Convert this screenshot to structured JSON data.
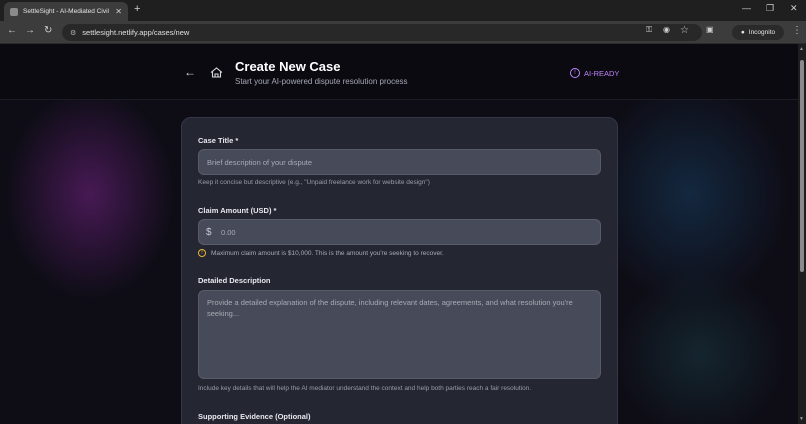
{
  "browser": {
    "tab_title": "SettleSight - AI-Mediated Civil Dispute",
    "tab_close": "✕",
    "new_tab": "+",
    "url": "settlesight.netlify.app/cases/new",
    "incognito_label": "Incognito",
    "window_controls": [
      "—",
      "❐",
      "✕"
    ]
  },
  "header": {
    "title": "Create New Case",
    "subtitle": "Start your AI-powered dispute resolution process",
    "badge": "AI-READY",
    "badge_color": "#c084fc"
  },
  "form": {
    "case_title": {
      "label": "Case Title *",
      "placeholder": "Brief description of your dispute",
      "help": "Keep it concise but descriptive (e.g., \"Unpaid freelance work for website design\")"
    },
    "claim_amount": {
      "label": "Claim Amount (USD) *",
      "currency_symbol": "$",
      "placeholder": "0.00",
      "warning": "Maximum claim amount is $10,000. This is the amount you're seeking to recover.",
      "warning_color": "#e4b33c"
    },
    "description": {
      "label": "Detailed Description",
      "placeholder": "Provide a detailed explanation of the dispute, including relevant dates, agreements, and what resolution you're seeking...",
      "help": "Include key details that will help the AI mediator understand the context and help both parties reach a fair resolution."
    },
    "evidence": {
      "label": "Supporting Evidence (Optional)"
    }
  }
}
